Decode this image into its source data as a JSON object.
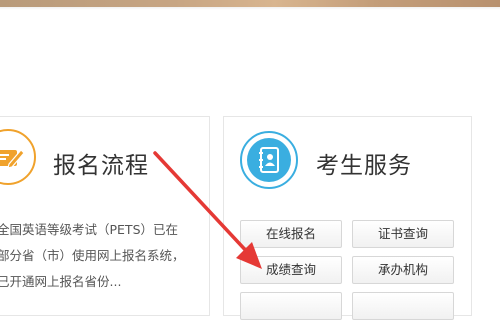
{
  "left_panel": {
    "title": "报名流程",
    "icon": "form-pen-icon",
    "accent_color": "#f0a22c",
    "description_lines": [
      "全国英语等级考试（PETS）已在",
      "部分省（市）使用网上报名系统，",
      "已开通网上报名省份..."
    ]
  },
  "right_panel": {
    "title": "考生服务",
    "icon": "address-book-icon",
    "accent_color": "#3aaee0",
    "buttons": [
      "在线报名",
      "证书查询",
      "成绩查询",
      "承办机构",
      "",
      ""
    ]
  },
  "annotation": {
    "icon": "red-arrow-icon",
    "color": "#e53935"
  }
}
